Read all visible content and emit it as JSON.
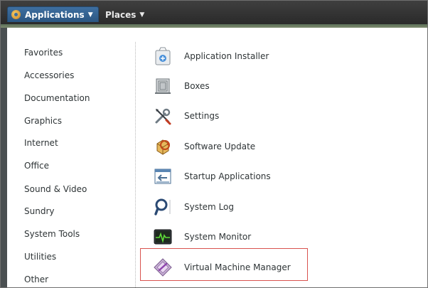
{
  "topbar": {
    "applications_label": "Applications",
    "places_label": "Places",
    "caret": "▼"
  },
  "categories": [
    "Favorites",
    "Accessories",
    "Documentation",
    "Graphics",
    "Internet",
    "Office",
    "Sound & Video",
    "Sundry",
    "System Tools",
    "Utilities",
    "Other"
  ],
  "apps": [
    {
      "label": "Application Installer",
      "icon": "package-installer-icon"
    },
    {
      "label": "Boxes",
      "icon": "boxes-icon"
    },
    {
      "label": "Settings",
      "icon": "settings-tools-icon"
    },
    {
      "label": "Software Update",
      "icon": "software-update-icon"
    },
    {
      "label": "Startup Applications",
      "icon": "startup-applications-icon"
    },
    {
      "label": "System Log",
      "icon": "system-log-icon"
    },
    {
      "label": "System Monitor",
      "icon": "system-monitor-icon"
    },
    {
      "label": "Virtual Machine Manager",
      "icon": "virtual-machine-manager-icon"
    }
  ],
  "colors": {
    "accent": "#2b5682",
    "highlight_border": "#d9534f"
  }
}
